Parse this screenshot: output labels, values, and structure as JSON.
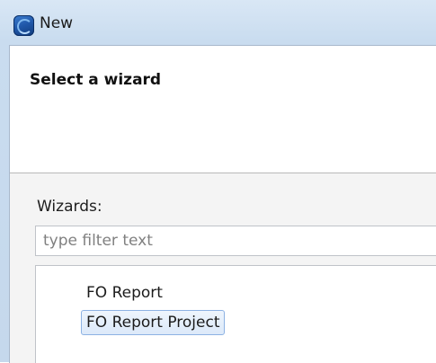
{
  "window": {
    "title": "New",
    "icon": "eclipse-app-icon"
  },
  "banner": {
    "title": "Select a wizard"
  },
  "wizards": {
    "label": "Wizards:",
    "filter_placeholder": "type filter text",
    "items": [
      {
        "label": "FO Report",
        "selected": false
      },
      {
        "label": "FO Report Project",
        "selected": true
      }
    ]
  }
}
